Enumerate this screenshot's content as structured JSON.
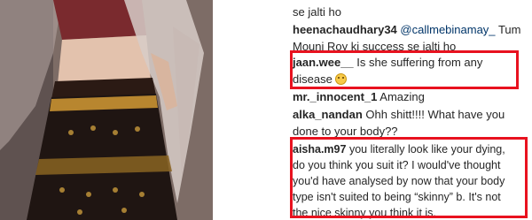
{
  "comments": [
    {
      "user": "",
      "mention": "",
      "text_lines": [
        "se jalti ho"
      ]
    },
    {
      "user": "heenachaudhary34",
      "mention": "@callmebinamay_",
      "text_lines": [
        "Tum",
        "Mouni Roy ki success se jalti ho"
      ]
    },
    {
      "user": "jaan.wee__",
      "mention": "",
      "text_lines": [
        "Is she suffering from any",
        "disease"
      ],
      "emoji": "face-with-rolling-eyes-icon"
    },
    {
      "user": "mr._innocent_1",
      "mention": "",
      "text_lines": [
        "Amazing"
      ]
    },
    {
      "user": "alka_nandan",
      "mention": "",
      "text_lines": [
        "Ohh shitt!!!! What have you",
        "done to your body??"
      ]
    },
    {
      "user": "aisha.m97",
      "mention": "",
      "text_lines": [
        "you literally look like your dying,",
        "do you think you suit it? I would've thought",
        "you'd have analysed by now that your body",
        "type isn't suited to being “skinny” b. It's not",
        "the nice skinny you think it is."
      ]
    }
  ],
  "colors": {
    "highlight": "#e8121f",
    "username": "#262626",
    "mention": "#003569",
    "text": "#262626"
  }
}
